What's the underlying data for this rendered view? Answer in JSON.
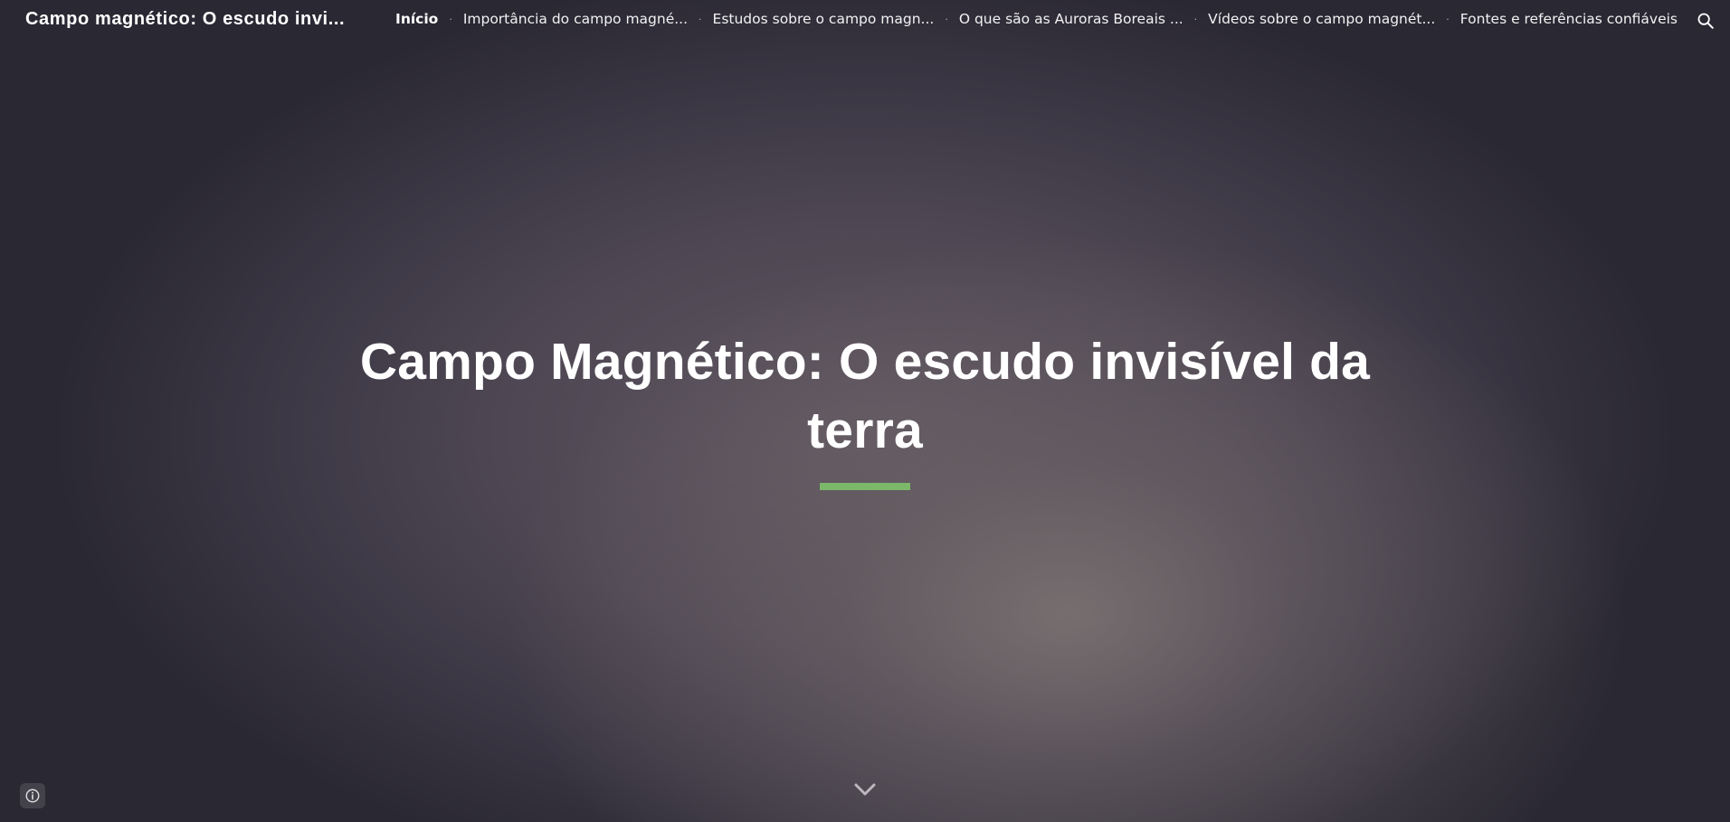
{
  "site": {
    "title": "Campo magnético: O escudo invi..."
  },
  "nav": {
    "items": [
      {
        "label": "Início",
        "active": true
      },
      {
        "label": "Importância do campo magné..."
      },
      {
        "label": "Estudos sobre o campo magn..."
      },
      {
        "label": "O que são as Auroras Boreais ..."
      },
      {
        "label": "Vídeos sobre o campo magnét..."
      },
      {
        "label": "Fontes e referências confiáveis"
      }
    ],
    "separator": "·"
  },
  "icons": {
    "search": "search-icon",
    "scroll_down": "chevron-down-icon",
    "info": "info-icon"
  },
  "hero": {
    "title": "Campo Magnético: O escudo invisível da terra"
  },
  "colors": {
    "accent": "#7cb86a",
    "text": "#ffffff"
  }
}
